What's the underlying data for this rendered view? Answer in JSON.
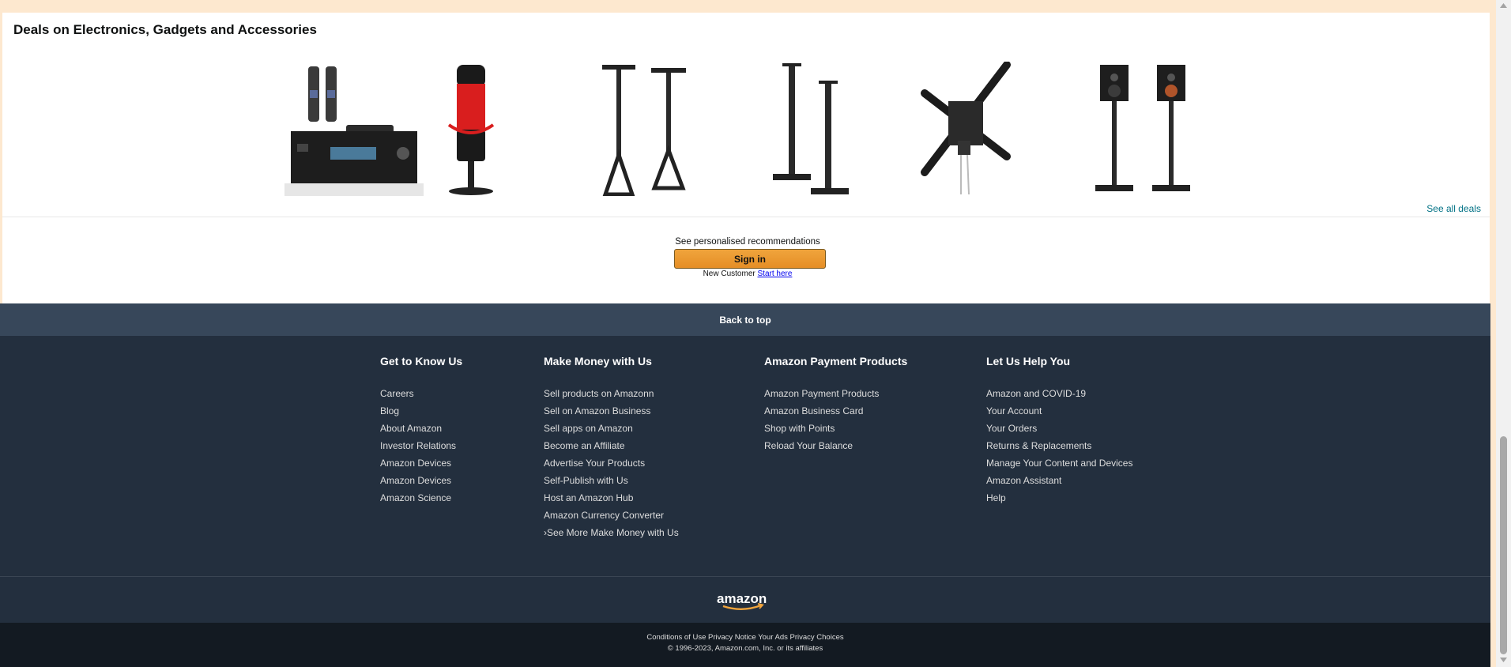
{
  "deals": {
    "title": "Deals on Electronics, Gadgets and Accessories",
    "see_all": "See all deals",
    "products": [
      {
        "icon": "av-receiver-with-microphones"
      },
      {
        "icon": "red-black-usb-microphone"
      },
      {
        "icon": "tall-speaker-stands-pair"
      },
      {
        "icon": "bookshelf-speaker-stands-pair"
      },
      {
        "icon": "tv-wall-mount-bracket"
      },
      {
        "icon": "bookshelf-speakers-on-stands"
      }
    ]
  },
  "signin": {
    "reco_text": "See personalised recommendations",
    "button_label": "Sign in",
    "new_customer": "New Customer",
    "start_here": "Start here"
  },
  "back_to_top": "Back to top",
  "footer": {
    "columns": [
      {
        "title": "Get to Know Us",
        "links": [
          "Careers",
          "Blog",
          "About Amazon",
          "Investor Relations",
          "Amazon Devices",
          "Amazon Devices",
          "Amazon Science"
        ]
      },
      {
        "title": "Make Money with Us",
        "links": [
          "Sell products on Amazonn",
          "Sell on Amazon Business",
          "Sell apps on Amazon",
          "Become an Affiliate",
          "Advertise Your Products",
          "Self-Publish with Us",
          "Host an Amazon Hub",
          "Amazon Currency Converter",
          "›See More Make Money with Us"
        ]
      },
      {
        "title": "Amazon Payment Products",
        "links": [
          "Amazon Payment Products",
          "Amazon Business Card",
          "Shop with Points",
          "Reload Your Balance"
        ]
      },
      {
        "title": "Let Us Help You",
        "links": [
          "Amazon and COVID-19",
          "Your Account",
          "Your Orders",
          "Returns & Replacements",
          "Manage Your Content and Devices",
          "Amazon Assistant",
          "Help"
        ]
      }
    ],
    "logo_text": "amazon",
    "legal_links": [
      "Conditions of Use",
      "Privacy Notice",
      "Your Ads Privacy Choices"
    ],
    "copyright": "© 1996-2023, Amazon.com, Inc. or its affiliates"
  },
  "colors": {
    "accent_button": "#e8962e",
    "nav_dark": "#232f3e",
    "back_to_top": "#37475a",
    "link_teal": "#007185"
  }
}
